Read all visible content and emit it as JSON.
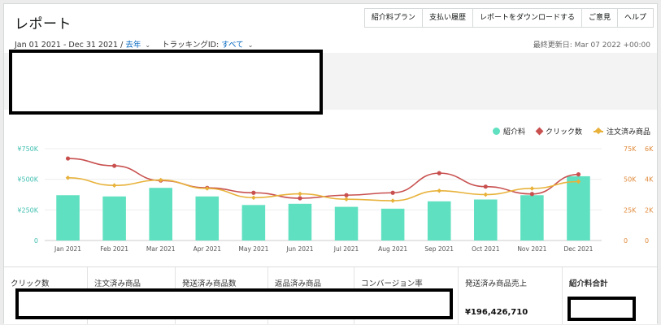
{
  "header": {
    "title": "レポート",
    "tabs": [
      "紹介料プラン",
      "支払い履歴",
      "レポートをダウンロードする",
      "ご意見",
      "ヘルプ"
    ]
  },
  "filters": {
    "date_range": "Jan 01 2021 - Dec 31 2021 /",
    "period_link": "去年",
    "tracking_label": "トラッキングID:",
    "tracking_value": "すべて"
  },
  "last_updated": "最終更新日: Mar 07 2022 +00:00",
  "legend": {
    "fees": "紹介料",
    "clicks": "クリック数",
    "ordered": "注文済み商品"
  },
  "colors": {
    "bars": "#5fe0c0",
    "clicks": "#c8504f",
    "ordered": "#e8b23a",
    "left_axis": "#3fbfb0",
    "right_axis": "#e08a3a"
  },
  "chart_data": {
    "type": "bar",
    "categories": [
      "Jan 2021",
      "Feb 2021",
      "Mar 2021",
      "Apr 2021",
      "May 2021",
      "Jun 2021",
      "Jul 2021",
      "Aug 2021",
      "Sep 2021",
      "Oct 2021",
      "Nov 2021",
      "Dec 2021"
    ],
    "series": [
      {
        "name": "紹介料",
        "type": "bar",
        "axis": "left",
        "values": [
          370000,
          360000,
          430000,
          360000,
          290000,
          300000,
          275000,
          260000,
          320000,
          335000,
          370000,
          525000
        ]
      },
      {
        "name": "クリック数",
        "type": "line",
        "axis": "right1",
        "values": [
          67000,
          61000,
          49000,
          43000,
          39000,
          34500,
          37000,
          39000,
          55000,
          44000,
          38000,
          54000
        ]
      },
      {
        "name": "注文済み商品",
        "type": "line",
        "axis": "right2",
        "values": [
          4100,
          3600,
          3950,
          3400,
          2800,
          3050,
          2700,
          2600,
          3250,
          3000,
          3400,
          3850
        ]
      }
    ],
    "left_axis": {
      "ticks": [
        "0",
        "¥250K",
        "¥500K",
        "¥750K"
      ],
      "max": 750000
    },
    "right1_axis": {
      "ticks": [
        "0",
        "25K",
        "50K",
        "75K"
      ],
      "max": 75000
    },
    "right2_axis": {
      "ticks": [
        "0",
        "2K",
        "4K",
        "6K"
      ],
      "max": 6000
    },
    "grid": true,
    "legend_position": "top-right"
  },
  "metrics": [
    {
      "label": "クリック数",
      "value": ""
    },
    {
      "label": "注文済み商品",
      "value": ""
    },
    {
      "label": "発送済み商品数",
      "value": ""
    },
    {
      "label": "返品済み商品",
      "value": ""
    },
    {
      "label": "コンバージョン率",
      "value": ""
    },
    {
      "label": "発送済み商品売上",
      "value": "¥196,426,710"
    },
    {
      "label": "紹介料合計",
      "value": ""
    }
  ]
}
